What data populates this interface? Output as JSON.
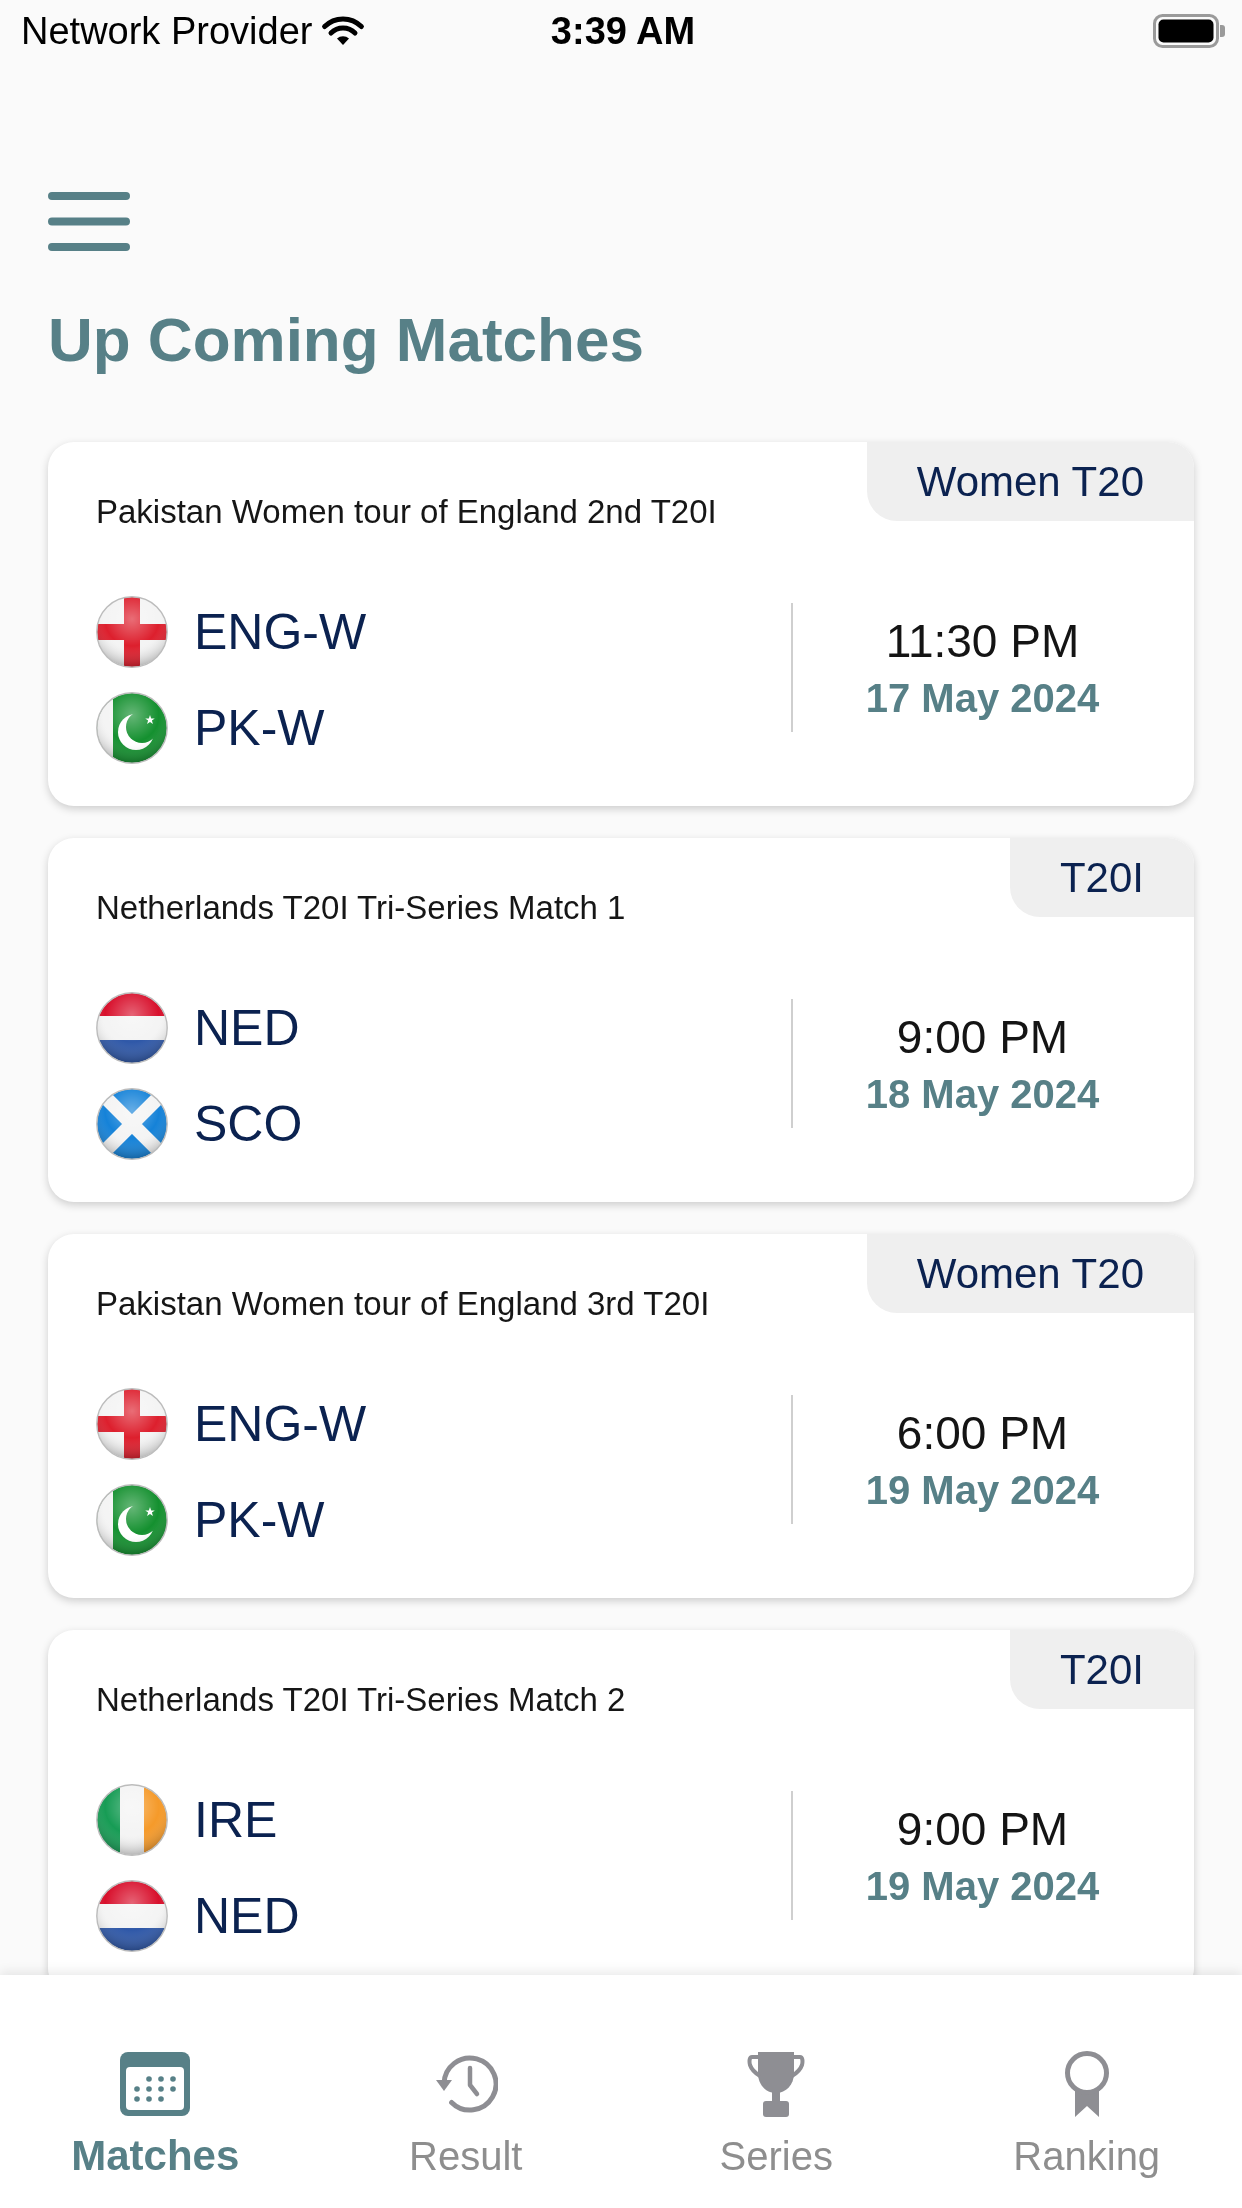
{
  "status_bar": {
    "carrier": "Network Provider",
    "time": "3:39 AM"
  },
  "header": {
    "title": "Up Coming Matches"
  },
  "matches": [
    {
      "format": "Women T20",
      "title": "Pakistan Women tour of England 2nd T20I",
      "teams": [
        {
          "kind": "england",
          "code": "ENG-W"
        },
        {
          "kind": "pakistan",
          "code": "PK-W"
        }
      ],
      "time": "11:30 PM",
      "date": "17 May 2024"
    },
    {
      "format": "T20I",
      "title": "Netherlands T20I Tri-Series Match 1",
      "teams": [
        {
          "kind": "netherlands",
          "code": "NED"
        },
        {
          "kind": "scotland",
          "code": "SCO"
        }
      ],
      "time": "9:00 PM",
      "date": "18 May 2024"
    },
    {
      "format": "Women T20",
      "title": "Pakistan Women tour of England 3rd T20I",
      "teams": [
        {
          "kind": "england",
          "code": "ENG-W"
        },
        {
          "kind": "pakistan",
          "code": "PK-W"
        }
      ],
      "time": "6:00 PM",
      "date": "19 May 2024"
    },
    {
      "format": "T20I",
      "title": "Netherlands T20I Tri-Series Match 2",
      "teams": [
        {
          "kind": "ireland",
          "code": "IRE"
        },
        {
          "kind": "netherlands",
          "code": "NED"
        }
      ],
      "time": "9:00 PM",
      "date": "19 May 2024"
    }
  ],
  "bottom_nav": [
    {
      "kind": "calendar",
      "label": "Matches",
      "selected": true
    },
    {
      "kind": "history",
      "label": "Result",
      "selected": false
    },
    {
      "kind": "trophy",
      "label": "Series",
      "selected": false
    },
    {
      "kind": "award",
      "label": "Ranking",
      "selected": false
    }
  ]
}
